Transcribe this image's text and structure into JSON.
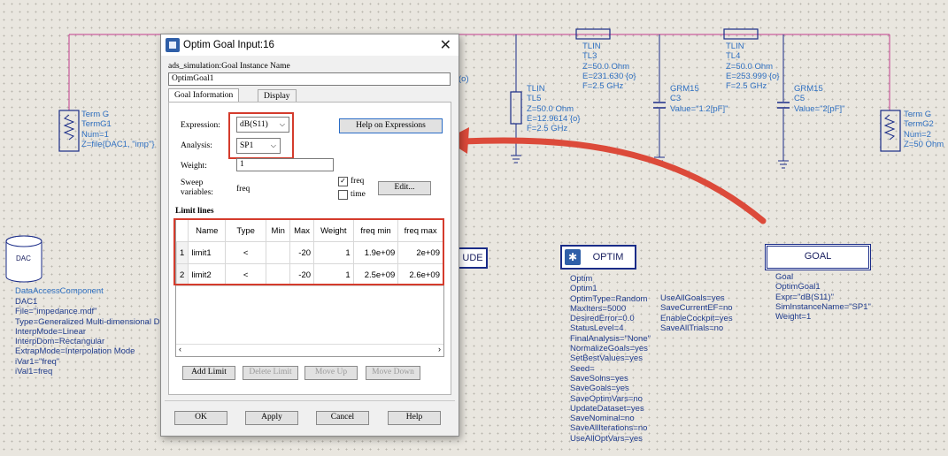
{
  "dialog": {
    "title": "Optim Goal Input:16",
    "instance_label": "ads_simulation:Goal Instance Name",
    "instance_value": "OptimGoal1",
    "tabs": [
      "Goal Information",
      "Display"
    ],
    "expression_label": "Expression:",
    "expression_value": "dB(S11)",
    "analysis_label": "Analysis:",
    "analysis_value": "SP1",
    "weight_label": "Weight:",
    "weight_value": "1",
    "sweep_label": "Sweep\nvariables:",
    "sweep_value": "freq",
    "help_expr_label": "Help on Expressions",
    "check_freq": "freq",
    "check_time": "time",
    "edit_label": "Edit...",
    "limit_lines_label": "Limit lines",
    "table_headers": [
      "Name",
      "Type",
      "Min",
      "Max",
      "Weight",
      "freq min",
      "freq max"
    ],
    "rows": [
      {
        "idx": "1",
        "name": "limit1",
        "type": "<",
        "min": "",
        "max": "-20",
        "weight": "1",
        "fmin": "1.9e+09",
        "fmax": "2e+09"
      },
      {
        "idx": "2",
        "name": "limit2",
        "type": "<",
        "min": "",
        "max": "-20",
        "weight": "1",
        "fmin": "2.5e+09",
        "fmax": "2.6e+09"
      }
    ],
    "btn_add_limit": "Add Limit",
    "btn_delete_limit": "Delete Limit",
    "btn_move_up": "Move Up",
    "btn_move_down": "Move Down",
    "btn_ok": "OK",
    "btn_apply": "Apply",
    "btn_cancel": "Cancel",
    "btn_help": "Help"
  },
  "schematic": {
    "termg1": "Term G\nTermG1\nNum=1\nZ=file{DAC1, \"imp\"}",
    "termg2": "Term G\nTermG2\nNum=2\nZ=50 Ohm",
    "tl3": "TLIN\nTL3\nZ=50.0 Ohm\nE=231.630 {o}\nF=2.5 GHz",
    "tl4": "TLIN\nTL4\nZ=50.0 Ohm\nE=253.999 {o}\nF=2.5 GHz",
    "tl5": "TLIN\nTL5\nZ=50.0 Ohm\nE=12.9614 {o}\nF=2.5 GHz",
    "c3": "GRM15\nC3\nValue=\"1.2[pF]\"",
    "c5": "GRM15\nC5\nValue=\"2[pF]\"",
    "tl_partial": "(o)",
    "dac_icon_label": "DAC",
    "dac_title": "DataAccessComponent",
    "dac_params": "DAC1\nFile=\"impedance.mdf\"\nType=Generalized Multi-dimensional D\nInterpMode=Linear\nInterpDom=Rectangular\nExtrapMode=Interpolation Mode\niVar1=\"freq\"\niVal1=freq",
    "optim_box": "OPTIM",
    "optim_params_col1": "Optim\nOptim1\nOptimType=Random\nMaxIters=5000\nDesiredError=0.0\nStatusLevel=4\nFinalAnalysis=\"None\"\nNormalizeGoals=yes\nSetBestValues=yes\nSeed=\nSaveSolns=yes\nSaveGoals=yes\nSaveOptimVars=no\nUpdateDataset=yes\nSaveNominal=no\nSaveAllIterations=no\nUseAllOptVars=yes",
    "optim_params_col2": "UseAllGoals=yes\nSaveCurrentEF=no\nEnableCockpit=yes\nSaveAllTrials=no",
    "goal_box": "GOAL",
    "goal_params": "Goal\nOptimGoal1\nExpr=\"dB(S11)\"\nSimInstanceName=\"SP1\"\nWeight=1",
    "partial_box": "UDE"
  }
}
